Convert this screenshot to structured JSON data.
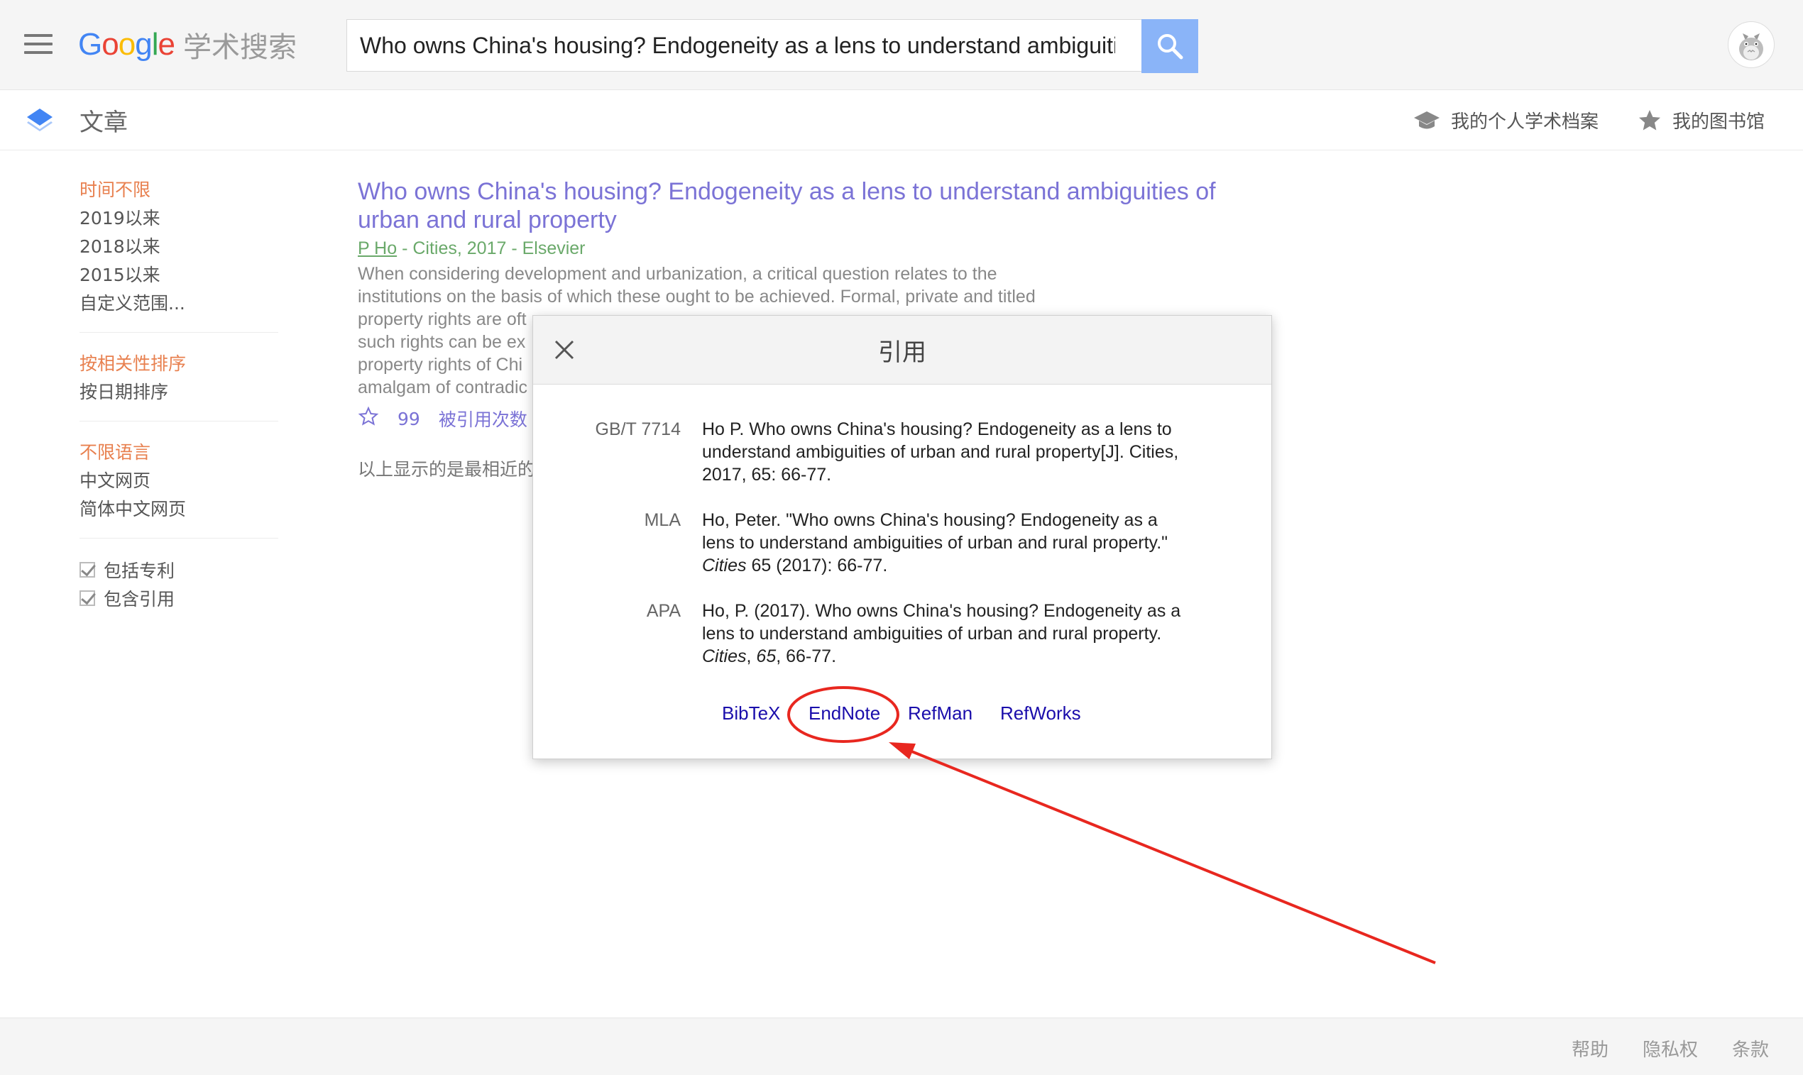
{
  "header": {
    "logo_word": [
      "G",
      "o",
      "o",
      "g",
      "l",
      "e"
    ],
    "logo_sub": "学术搜索",
    "search_value": "Who owns China's housing? Endogeneity as a lens to understand ambiguities of urban and rural property",
    "menu_icon": "hamburger-menu-icon",
    "search_icon": "magnifier-icon",
    "avatar_icon": "totoro-avatar-icon"
  },
  "subheader": {
    "section_title": "文章",
    "profile_label": "我的个人学术档案",
    "library_label": "我的图书馆"
  },
  "sidebar": {
    "time_filters": [
      "时间不限",
      "2019以来",
      "2018以来",
      "2015以来",
      "自定义范围..."
    ],
    "sort_options": [
      "按相关性排序",
      "按日期排序"
    ],
    "language_options": [
      "不限语言",
      "中文网页",
      "简体中文网页"
    ],
    "checks": [
      "包括专利",
      "包含引用"
    ]
  },
  "result": {
    "title": "Who owns China's housing? Endogeneity as a lens to understand ambiguities of urban and rural property",
    "author": "P Ho",
    "meta_rest": " - Cities, 2017 - Elsevier",
    "snippet_lines": [
      "When considering development and urbanization, a critical question relates to the",
      "institutions on the basis of which these ought to be achieved. Formal, private and titled",
      "property rights are oft",
      "such rights can be ex",
      "property rights of Chi",
      "amalgam of contradic"
    ],
    "cited_by": "被引用次数",
    "quote_glyph": "99"
  },
  "showing_note": "以上显示的是最相近的",
  "modal": {
    "title": "引用",
    "citations": [
      {
        "label": "GB/T 7714",
        "lines": [
          "Ho P. Who owns China's housing? Endogeneity as a lens to",
          "understand ambiguities of urban and rural property[J]. Cities,",
          "2017, 65: 66-77."
        ]
      },
      {
        "label": "MLA",
        "lines": [
          "Ho, Peter. \"Who owns China's housing? Endogeneity as a",
          "lens to understand ambiguities of urban and rural property.\""
        ],
        "journal": "Cities",
        "tail": " 65 (2017): 66-77."
      },
      {
        "label": "APA",
        "lines": [
          "Ho, P. (2017). Who owns China's housing? Endogeneity as a",
          "lens to understand ambiguities of urban and rural property."
        ],
        "journal": "Cities",
        "sep": ", ",
        "volume": "65",
        "tail": ", 66-77."
      }
    ],
    "exports": [
      "BibTeX",
      "EndNote",
      "RefMan",
      "RefWorks"
    ]
  },
  "annotation": {
    "color": "#e8271f",
    "highlight": "EndNote"
  },
  "footer": {
    "links": [
      "帮助",
      "隐私权",
      "条款"
    ]
  }
}
